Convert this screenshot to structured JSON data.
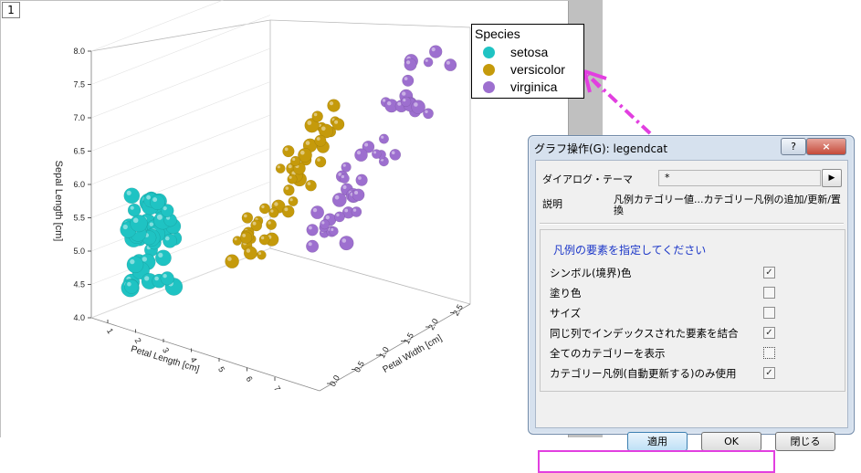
{
  "graph": {
    "layer_index": "1",
    "legend": {
      "title": "Species",
      "items": [
        {
          "label": "setosa",
          "color": "#1fc3c3"
        },
        {
          "label": "versicolor",
          "color": "#c59a0b"
        },
        {
          "label": "virginica",
          "color": "#9d6fcf"
        }
      ]
    },
    "axes": {
      "z_label": "Sepal Length [cm]",
      "z_ticks": [
        "4.0",
        "4.5",
        "5.0",
        "5.5",
        "6.0",
        "6.5",
        "7.0",
        "7.5",
        "8.0"
      ],
      "x_label": "Petal Length [cm]",
      "x_ticks": [
        "1",
        "2",
        "3",
        "4",
        "5",
        "6",
        "7"
      ],
      "y_label": "Petal Width [cm]",
      "y_ticks": [
        "0.0",
        "0.5",
        "1.0",
        "1.5",
        "2.0",
        "2.5"
      ]
    },
    "arrow_color": "#e23fe0"
  },
  "dialog": {
    "title": "グラフ操作(G): legendcat",
    "help_button": "?",
    "close_button": "×",
    "theme_label": "ダイアログ・テーマ",
    "theme_value": "*",
    "theme_arrow": "▶",
    "description_label": "説明",
    "description_text": "凡例カテゴリー値...カテゴリー凡例の追加/更新/置換",
    "group_heading": "凡例の要素を指定してください",
    "options": [
      {
        "label": "シンボル(境界)色",
        "checked": true
      },
      {
        "label": "塗り色",
        "checked": false
      },
      {
        "label": "サイズ",
        "checked": false
      },
      {
        "label": "同じ列でインデックスされた要素を結合",
        "checked": true
      },
      {
        "label": "全てのカテゴリーを表示",
        "checked": false
      },
      {
        "label": "カテゴリー凡例(自動更新する)のみ使用",
        "checked": true
      }
    ],
    "buttons": {
      "apply": "適用",
      "ok": "OK",
      "close": "閉じる"
    }
  }
}
